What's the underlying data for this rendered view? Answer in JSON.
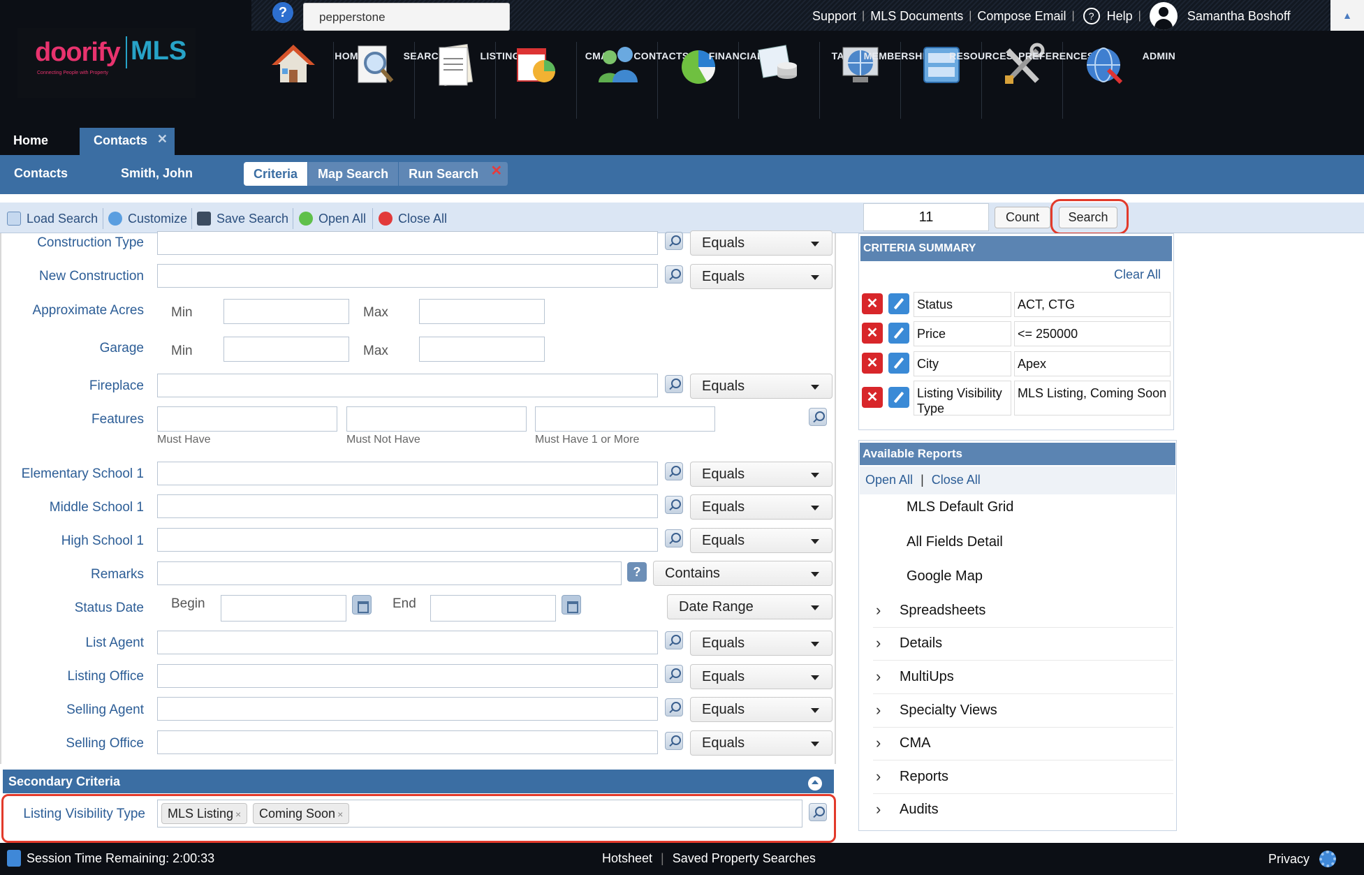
{
  "header": {
    "quick_search_value": "pepperstone",
    "help_label": "?",
    "links": [
      "Support",
      "MLS Documents",
      "Compose Email"
    ],
    "help_link": "Help",
    "user_name": "Samantha Boshoff",
    "logo_brand": "doorify",
    "logo_mls": "MLS",
    "logo_tagline": "Connecting People with Property",
    "nav": [
      {
        "label": "HOME",
        "icon": "house-icon"
      },
      {
        "label": "SEARCH",
        "icon": "magnifier-document-icon"
      },
      {
        "label": "LISTINGS",
        "icon": "listings-document-icon"
      },
      {
        "label": "CMA",
        "icon": "cma-chart-icon"
      },
      {
        "label": "CONTACTS",
        "icon": "contacts-people-icon"
      },
      {
        "label": "FINANCIALS",
        "icon": "pie-chart-icon"
      },
      {
        "label": "TAX",
        "icon": "tax-coins-icon"
      },
      {
        "label": "MEMBERSHIP",
        "icon": "membership-globe-icon"
      },
      {
        "label": "RESOURCES",
        "icon": "resources-cabinet-icon"
      },
      {
        "label": "PREFERENCES",
        "icon": "tools-icon"
      },
      {
        "label": "ADMIN",
        "icon": "admin-globe-icon"
      }
    ]
  },
  "tabs": {
    "home": "Home",
    "contacts": "Contacts",
    "close": "✕"
  },
  "subbar": {
    "contacts": "Contacts",
    "contact_name": "Smith, John",
    "tabs": [
      "Criteria",
      "Map Search",
      "Run Search"
    ],
    "close": "✕"
  },
  "toolbar": {
    "load": "Load Search",
    "customize": "Customize",
    "save": "Save Search",
    "open_all": "Open All",
    "close_all": "Close All",
    "count_value": "11",
    "count_btn": "Count",
    "search_btn": "Search"
  },
  "form": {
    "construction_type": {
      "label": "Construction Type",
      "op": "Equals"
    },
    "new_construction": {
      "label": "New Construction",
      "op": "Equals"
    },
    "approx_acres": {
      "label": "Approximate Acres",
      "min": "Min",
      "max": "Max"
    },
    "garage": {
      "label": "Garage",
      "min": "Min",
      "max": "Max"
    },
    "fireplace": {
      "label": "Fireplace",
      "op": "Equals"
    },
    "features": {
      "label": "Features",
      "must_have": "Must Have",
      "must_not_have": "Must Not Have",
      "must_have_one": "Must Have 1 or More"
    },
    "elementary": {
      "label": "Elementary School 1",
      "op": "Equals"
    },
    "middle": {
      "label": "Middle School 1",
      "op": "Equals"
    },
    "high": {
      "label": "High School 1",
      "op": "Equals"
    },
    "remarks": {
      "label": "Remarks",
      "op": "Contains",
      "help": "?"
    },
    "status_date": {
      "label": "Status Date",
      "begin": "Begin",
      "end": "End",
      "op": "Date Range"
    },
    "list_agent": {
      "label": "List Agent",
      "op": "Equals"
    },
    "listing_office": {
      "label": "Listing Office",
      "op": "Equals"
    },
    "selling_agent": {
      "label": "Selling Agent",
      "op": "Equals"
    },
    "selling_office": {
      "label": "Selling Office",
      "op": "Equals"
    }
  },
  "secondary": {
    "title": "Secondary Criteria",
    "lvt_label": "Listing Visibility Type",
    "chips": [
      "MLS Listing",
      "Coming Soon"
    ],
    "chip_remove": "×"
  },
  "criteria_summary": {
    "title": "CRITERIA SUMMARY",
    "clear_all": "Clear All",
    "remove": "✕",
    "rows": [
      {
        "field": "Status",
        "value": "ACT, CTG"
      },
      {
        "field": "Price",
        "value": "<= 250000"
      },
      {
        "field": "City",
        "value": "Apex"
      },
      {
        "field": "Listing Visibility Type",
        "value": "MLS Listing, Coming Soon"
      }
    ]
  },
  "reports": {
    "title": "Available Reports",
    "open_all": "Open All",
    "sep": "|",
    "close_all": "Close All",
    "items": [
      "MLS Default Grid",
      "All Fields Detail",
      "Google Map"
    ],
    "groups": [
      "Spreadsheets",
      "Details",
      "MultiUps",
      "Specialty Views",
      "CMA",
      "Reports",
      "Audits"
    ],
    "chevron": "›"
  },
  "footer": {
    "session": "Session Time Remaining: 2:00:33",
    "links": [
      "Hotsheet",
      "Saved Property Searches"
    ],
    "sep": "|",
    "privacy": "Privacy"
  },
  "colors": {
    "accent": "#3b6ea3",
    "highlight": "#e23a2b",
    "remove": "#d8262a",
    "edit": "#3a8ad6"
  }
}
